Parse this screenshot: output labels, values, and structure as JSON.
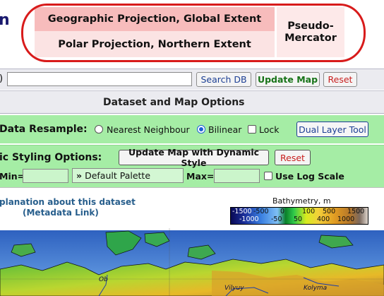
{
  "edge_text": "n",
  "projections": {
    "geographic": "Geographic Projection, Global Extent",
    "polar": "Polar Projection, Northern Extent",
    "mercator": "Pseudo-\nMercator",
    "highlight_color": "#d81b1b"
  },
  "search": {
    "paren": ")",
    "input_value": "",
    "search_button": "Search DB",
    "update_button": "Update Map",
    "reset_button": "Reset"
  },
  "options": {
    "header": "Dataset and Map Options",
    "resample_label": "Data Resample:",
    "nearest_label": "Nearest Neighbour",
    "bilinear_label": "Bilinear",
    "selected": "Bilinear",
    "lock_label": "Lock",
    "dual_button": "Dual Layer Tool"
  },
  "styling": {
    "label": "ic Styling Options:",
    "dynamic_button": "Update Map with Dynamic Style",
    "reset_button": "Reset",
    "min_label": "Min=",
    "min_value": "",
    "palette_icon": "double-chevron-right-icon",
    "palette_value": "Default Palette",
    "max_label": "Max=",
    "max_value": "",
    "log_label": "Use Log Scale",
    "log_checked": false
  },
  "info": {
    "explanation_text": "planation about this dataset",
    "metadata_link": "(Metadata Link)"
  },
  "colorbar": {
    "title": "Bathymetry, m",
    "ticks_top": [
      "-1500",
      "-500",
      "0",
      "100",
      "500",
      "1500"
    ],
    "ticks_bottom": [
      "-1000",
      "-50",
      "50",
      "400",
      "1000"
    ]
  },
  "map": {
    "labels": [
      "Ob",
      "Vilyuy",
      "Kolyma"
    ]
  },
  "colors": {
    "panel_gray": "#ebebf0",
    "panel_green": "#a5eda5",
    "link_blue": "#275e8c",
    "reset_red": "#c81e1e",
    "update_green": "#177318"
  }
}
